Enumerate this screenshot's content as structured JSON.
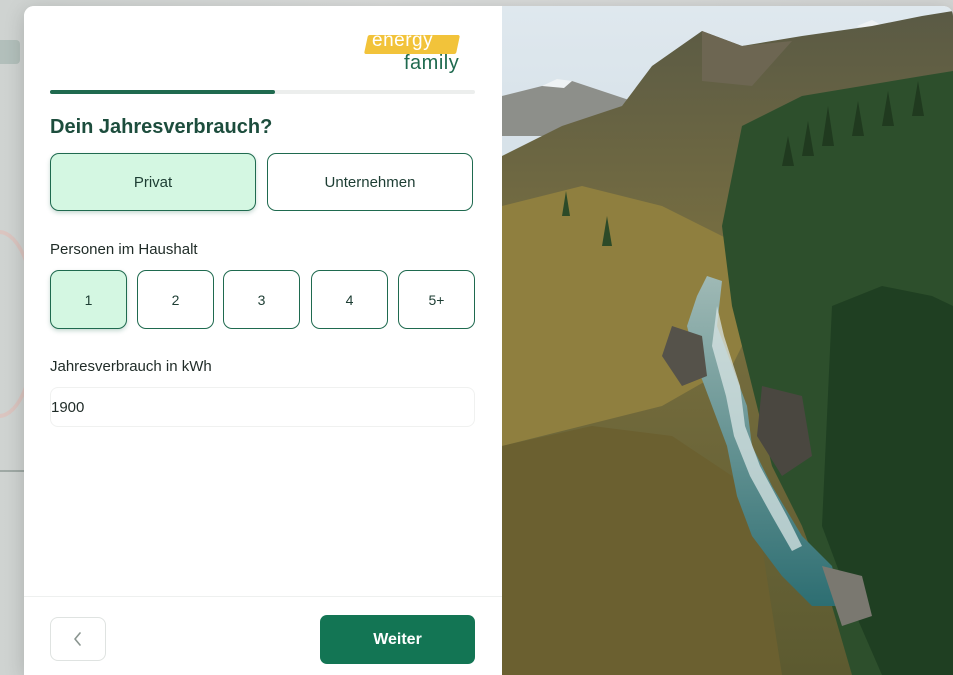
{
  "logo": {
    "line1": "energy",
    "line2": "family"
  },
  "progress": {
    "fraction": 0.53
  },
  "title": "Dein Jahresverbrauch?",
  "customer_type": {
    "options": [
      {
        "label": "Privat",
        "selected": true
      },
      {
        "label": "Unternehmen",
        "selected": false
      }
    ]
  },
  "persons": {
    "label": "Personen im Haushalt",
    "options": [
      {
        "label": "1",
        "selected": true
      },
      {
        "label": "2",
        "selected": false
      },
      {
        "label": "3",
        "selected": false
      },
      {
        "label": "4",
        "selected": false
      },
      {
        "label": "5+",
        "selected": false
      }
    ]
  },
  "consumption": {
    "label": "Jahresverbrauch in kWh",
    "value": "1900"
  },
  "footer": {
    "back_icon": "chevron-left-icon",
    "next_label": "Weiter"
  },
  "colors": {
    "primary": "#137554",
    "selected_bg": "#d4f7e2",
    "logo_yellow": "#f2c33a"
  },
  "photo": {
    "subject": "mountain-valley-river-photo"
  }
}
